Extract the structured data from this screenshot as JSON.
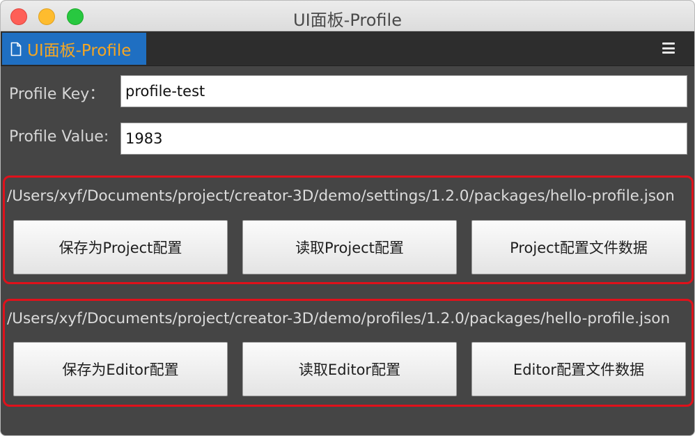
{
  "window": {
    "title": "UI面板-Profile"
  },
  "tab": {
    "label": "UI面板-Profile",
    "icon": "document-icon"
  },
  "menu": {
    "icon": "hamburger-menu-icon"
  },
  "fields": {
    "key": {
      "label": "Profile Key：",
      "value": "profile-test"
    },
    "value": {
      "label": "Profile Value:",
      "value": "1983"
    }
  },
  "project_group": {
    "path": "/Users/xyf/Documents/project/creator-3D/demo/settings/1.2.0/packages/hello-profile.json",
    "save_label": "保存为Project配置",
    "read_label": "读取Project配置",
    "data_label": "Project配置文件数据"
  },
  "editor_group": {
    "path": "/Users/xyf/Documents/project/creator-3D/demo/profiles/1.2.0/packages/hello-profile.json",
    "save_label": "保存为Editor配置",
    "read_label": "读取Editor配置",
    "data_label": "Editor配置文件数据"
  },
  "colors": {
    "panel_bg": "#454545",
    "tab_active": "#1f6fc2",
    "tab_label": "#f5a623",
    "highlight_border": "#e0111b"
  }
}
